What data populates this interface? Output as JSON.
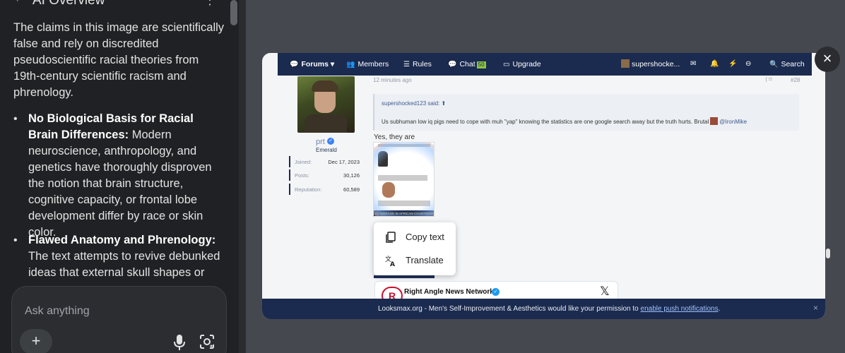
{
  "ai_panel": {
    "title": "AI Overview",
    "intro": "The claims in this image are scientifically false and rely on discredited pseudoscientific racial theories from 19th-century scientific racism and phrenology.",
    "bullets": [
      {
        "heading": "No Biological Basis for Racial Brain Differences:",
        "text": "Modern neuroscience, anthropology, and genetics have thoroughly disproven the notion that brain structure, cognitive capacity, or frontal lobe development differ by race or skin color."
      },
      {
        "heading": "Flawed Anatomy and Phrenology:",
        "text": "The text attempts to revive debunked ideas that external skull shapes or"
      }
    ],
    "ask_placeholder": "Ask anything",
    "add_label": "+"
  },
  "forum": {
    "nav": {
      "forums": "Forums",
      "members": "Members",
      "rules": "Rules",
      "chat": "Chat",
      "chat_badge": "50",
      "upgrade": "Upgrade",
      "user": "supershocke...",
      "search": "Search"
    },
    "post": {
      "time": "12 minutes ago",
      "number": "#28",
      "username": "prt",
      "user_title": "Emerald",
      "stats": [
        {
          "key": "Joined:",
          "value": "Dec 17, 2023"
        },
        {
          "key": "Posts:",
          "value": "30,126"
        },
        {
          "key": "Reputation:",
          "value": "60,589"
        }
      ],
      "quote_author": "supershocked123 said:",
      "quote_text": "Us subhuman low iq pigs need to cope with muh \"yap\" knowing the statistics are one google search away but the truth hurts. Brutal",
      "quote_mention": "@IronMike",
      "reply": "Yes, they are",
      "meme_caption": "IQ AVERAGE IN AFRICAN COUNTRIES(2017)"
    },
    "context_menu": {
      "copy": "Copy text",
      "translate": "Translate"
    },
    "embed": {
      "logo": "R",
      "name": "Right Angle News Network",
      "x_label": "𝕏"
    },
    "push_banner": {
      "text": "Looksmax.org - Men's Self-Improvement & Aesthetics would like your permission to ",
      "link": "enable push notifications",
      "end": ".",
      "close": "×"
    }
  },
  "viewer": {
    "close": "×"
  },
  "colors": {
    "nav_bg": "#1b2a4f",
    "panel_bg": "#1f2124",
    "accent_blue": "#3b82f6"
  }
}
